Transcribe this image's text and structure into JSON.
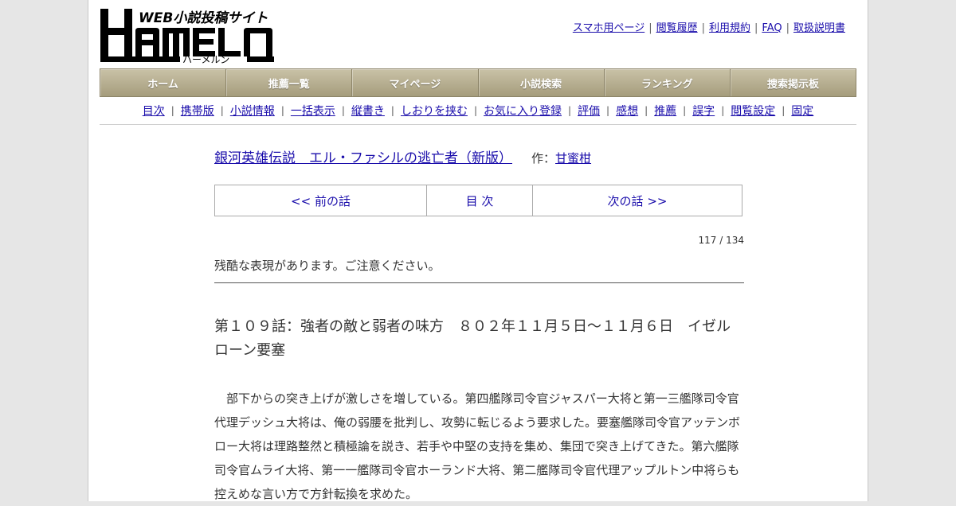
{
  "logo": {
    "tagline": "WEB小説投稿サイト",
    "wordmark": "HAMELN",
    "reading": "ハーメルン"
  },
  "toplinks": [
    {
      "label": "スマホ用ページ"
    },
    {
      "label": "閲覧履歴"
    },
    {
      "label": "利用規約"
    },
    {
      "label": "FAQ"
    },
    {
      "label": "取扱説明書"
    }
  ],
  "mainnav": [
    {
      "label": "ホーム"
    },
    {
      "label": "推薦一覧"
    },
    {
      "label": "マイページ"
    },
    {
      "label": "小説検索"
    },
    {
      "label": "ランキング"
    },
    {
      "label": "捜索掲示板"
    }
  ],
  "subnav": [
    {
      "label": "目次"
    },
    {
      "label": "携帯版"
    },
    {
      "label": "小説情報"
    },
    {
      "label": "一括表示"
    },
    {
      "label": "縦書き"
    },
    {
      "label": "しおりを挟む"
    },
    {
      "label": "お気に入り登録"
    },
    {
      "label": "評価"
    },
    {
      "label": "感想"
    },
    {
      "label": "推薦"
    },
    {
      "label": "誤字"
    },
    {
      "label": "閲覧設定"
    },
    {
      "label": "固定"
    }
  ],
  "novel": {
    "title": "銀河英雄伝説　エル・ファシルの逃亡者（新版）",
    "author_label": "作：",
    "author": "甘蜜柑"
  },
  "chapter_nav": {
    "prev": "<< 前の話",
    "toc": "目 次",
    "next": "次の話 >>"
  },
  "counter": "117 / 134",
  "warning": "残酷な表現があります。ご注意ください。",
  "chapter": {
    "title": "第１０９話：強者の敵と弱者の味方　８０２年１１月５日～１１月６日　イゼルローン要塞",
    "body": "　部下からの突き上げが激しさを増している。第四艦隊司令官ジャスパー大将と第一三艦隊司令官代理デッシュ大将は、俺の弱腰を批判し、攻勢に転じるよう要求した。要塞艦隊司令官アッテンボロー大将は理路整然と積極論を説き、若手や中堅の支持を集め、集団で突き上げてきた。第六艦隊司令官ムライ大将、第一一艦隊司令官ホーランド大将、第二艦隊司令官代理アップルトン中将らも控えめな言い方で方針転換を求めた。"
  },
  "colors": {
    "link": "#1a0dab",
    "nav_bar": "#b3ab8e",
    "logo_black": "#000000"
  }
}
